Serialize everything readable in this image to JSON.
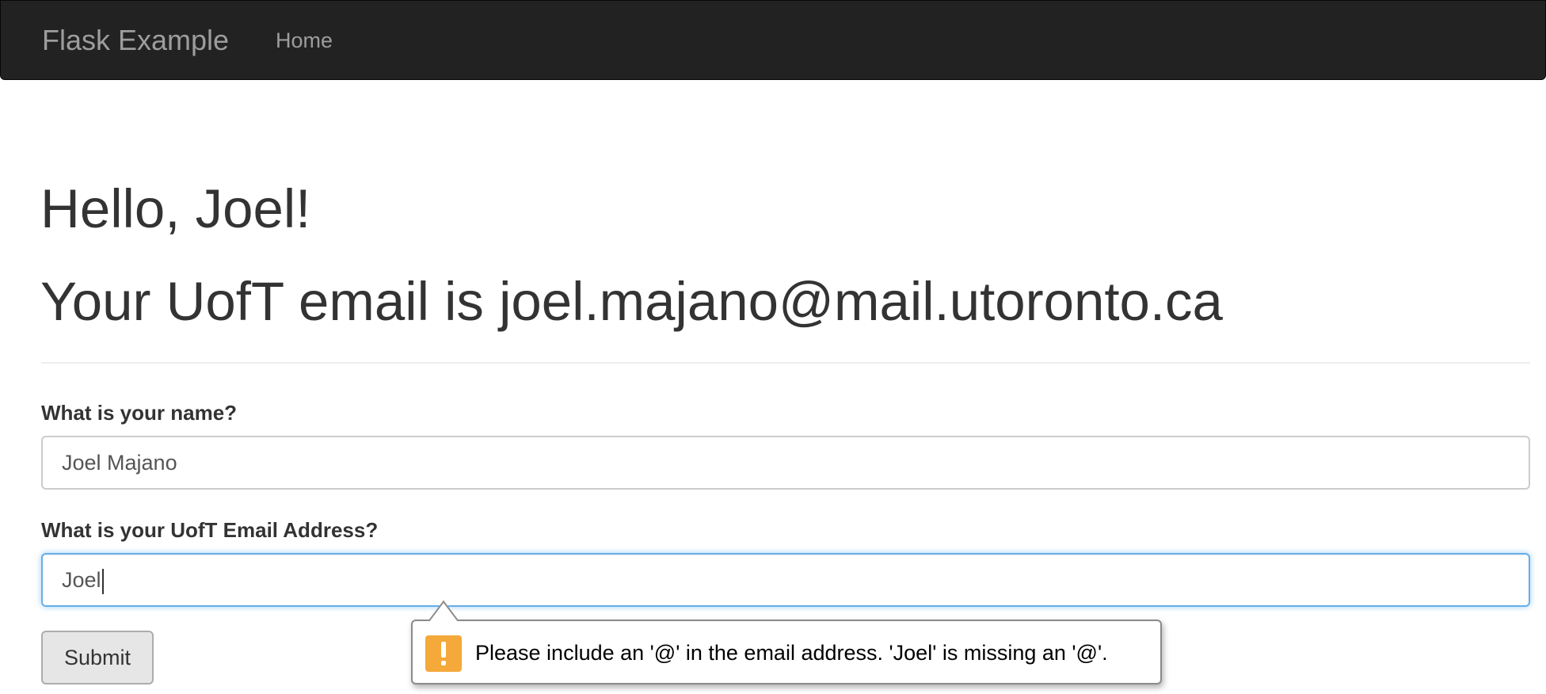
{
  "navbar": {
    "brand": "Flask Example",
    "links": [
      "Home"
    ]
  },
  "main": {
    "greeting": "Hello, Joel!",
    "email_heading": "Your UofT email is joel.majano@mail.utoronto.ca"
  },
  "form": {
    "name_label": "What is your name?",
    "name_value": "Joel Majano",
    "email_label": "What is your UofT Email Address?",
    "email_value": "Joel",
    "submit_label": "Submit"
  },
  "validation": {
    "message": "Please include an '@' in the email address. 'Joel' is missing an '@'.",
    "icon": "exclamation-warning-icon",
    "icon_color": "#f4a93a"
  },
  "colors": {
    "navbar_bg": "#222222",
    "navbar_text": "#9d9d9d",
    "focus_border": "#66afe9"
  }
}
